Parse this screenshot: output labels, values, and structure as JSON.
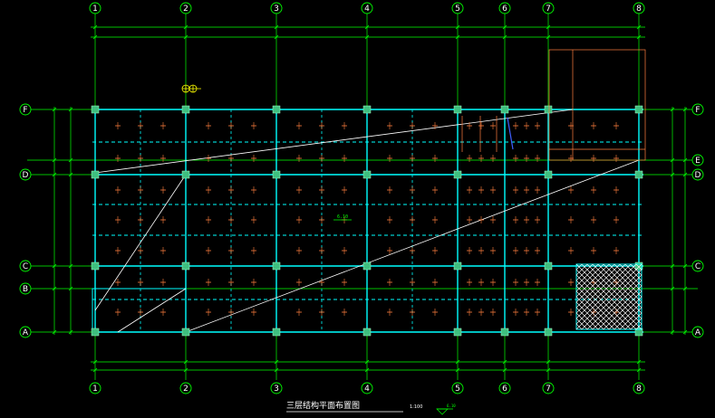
{
  "drawing": {
    "title": "三层结构平面布置图",
    "scale": "1:100",
    "scale_note": "6.10",
    "level_mark": "6.10"
  },
  "axes": {
    "vertical": [
      "1",
      "2",
      "3",
      "4",
      "5",
      "6",
      "7",
      "8"
    ],
    "horizontal_left": [
      "F",
      "D",
      "C",
      "B",
      "A"
    ],
    "horizontal_right": [
      "F",
      "E",
      "D",
      "C",
      "A"
    ]
  },
  "colors": {
    "background": "#000000",
    "grid_axis": "#00ff00",
    "beam": "#00ffff",
    "dimension": "#00ff00",
    "annotation": "#ff7f3f",
    "column": "#3fbf7f",
    "text": "#ffffff",
    "hatch": "#ffffff"
  }
}
